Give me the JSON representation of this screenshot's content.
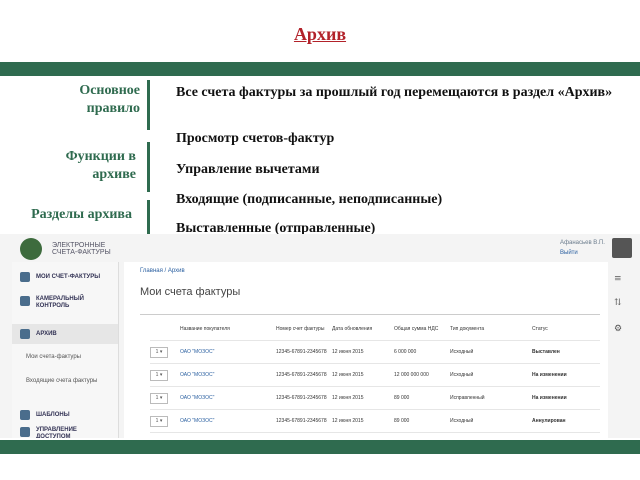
{
  "slide": {
    "title": "Архив",
    "rows": [
      {
        "label": "Основное правило",
        "text": "Все счета фактуры за прошлый год перемещаются в раздел «Архив»"
      },
      {
        "label": "Функции в архиве",
        "items": [
          "Просмотр счетов-фактур",
          "Управление вычетами"
        ]
      },
      {
        "label": "Разделы архива",
        "items": [
          "Входящие (подписанные, неподписанные)",
          "Выставленные (отправленные)"
        ]
      }
    ]
  },
  "app": {
    "brand": "ЭЛЕКТРОННЫЕ СЧЕТА-ФАКТУРЫ",
    "user": "Афанасьев В.П.",
    "logout": "Выйти",
    "breadcrumb": [
      "Главная",
      "Архив"
    ],
    "page_title": "Мои счета фактуры",
    "sidebar": [
      {
        "label": "МОИ СЧЕТ-ФАКТУРЫ",
        "icon": "invoice-icon"
      },
      {
        "label": "КАМЕРАЛЬНЫЙ КОНТРОЛЬ",
        "icon": "control-icon"
      },
      {
        "label": "АРХИВ",
        "icon": "archive-icon",
        "sub": [
          "Мои счета-фактуры",
          "Входящие счета фактуры"
        ]
      },
      {
        "label": "ШАБЛОНЫ",
        "icon": "templates-icon"
      },
      {
        "label": "УПРАВЛЕНИЕ ДОСТУПОМ",
        "icon": "access-icon"
      }
    ],
    "table": {
      "columns": [
        "Название покупателя",
        "Номер счет фактуры",
        "Дата обновления",
        "Общая сумма НДС",
        "Тип документа",
        "Статус"
      ],
      "rows": [
        {
          "name": "ОАО \"МОЗОС\"",
          "number": "12345-67891-2345678",
          "date": "12 июня 2015",
          "sum": "6 000 000",
          "type": "Исходный",
          "status": "Выставлен"
        },
        {
          "name": "ОАО \"МОЗОС\"",
          "number": "12345-67891-2345678",
          "date": "12 июня 2015",
          "sum": "12 000 000 000",
          "type": "Исходный",
          "status": "На изменении"
        },
        {
          "name": "ОАО \"МОЗОС\"",
          "number": "12345-67891-2345678",
          "date": "12 июня 2015",
          "sum": "89 000",
          "type": "Исправленный",
          "status": "На изменении"
        },
        {
          "name": "ОАО \"МОЗОС\"",
          "number": "12345-67891-2345678",
          "date": "12 июня 2015",
          "sum": "89 000",
          "type": "Исходный",
          "status": "Аннулирован"
        }
      ]
    }
  },
  "colors": {
    "green": "#2f6b4f",
    "title_red": "#b2222a"
  }
}
